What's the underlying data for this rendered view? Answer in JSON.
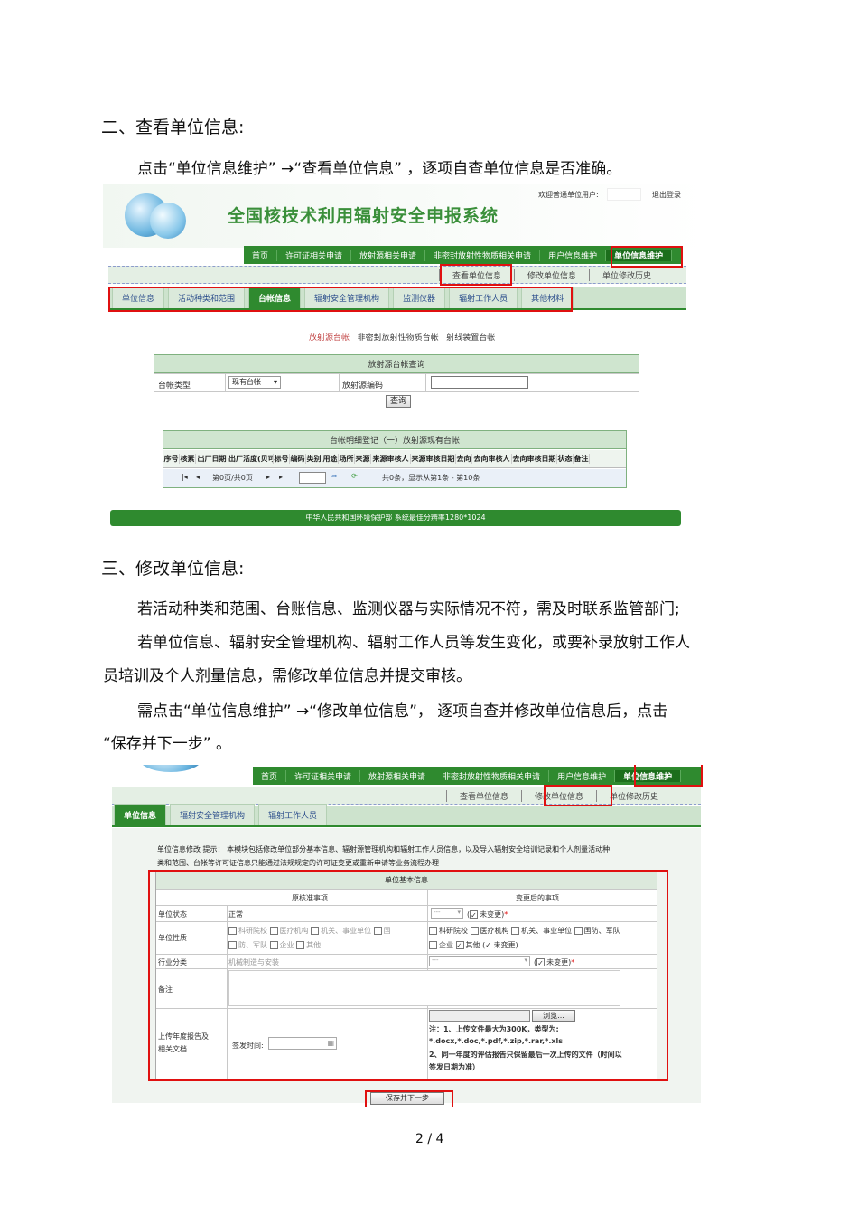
{
  "doc": {
    "h2a": "二、查看单位信息:",
    "p1": "点击“单位信息维护” →“查看单位信息” ，逐项自查单位信息是否准确。",
    "h2b": "三、修改单位信息:",
    "p2": "若活动种类和范围、台账信息、监测仪器与实际情况不符，需及时联系监管部门;",
    "p3a": "若单位信息、辐射安全管理机构、辐射工作人员等发生变化，或要补录放射工作人",
    "p3b": "员培训及个人剂量信息，需修改单位信息并提交审核。",
    "p4a": "需点击“单位信息维护” →“修改单位信息”， 逐项自查并修改单位信息后，点击",
    "p4b": "“保存并下一步” 。",
    "page": "2 / 4"
  },
  "shot1": {
    "sys_title": "全国核技术利用辐射安全申报系统",
    "welcome": "欢迎普通单位用户:",
    "logout": "退出登录",
    "nav": [
      "首页",
      "许可证相关申请",
      "放射源相关申请",
      "非密封放射性物质相关申请",
      "用户信息维护",
      "单位信息维护"
    ],
    "subnav": [
      "查看单位信息",
      "修改单位信息",
      "单位修改历史"
    ],
    "tabs": [
      "单位信息",
      "活动种类和范围",
      "台帐信息",
      "辐射安全管理机构",
      "监测仪器",
      "辐射工作人员",
      "其他材料"
    ],
    "ledger_links": [
      "放射源台帐",
      "非密封放射性物质台帐",
      "射线装置台帐"
    ],
    "query_title": "放射源台帐查询",
    "ledger_type_label": "台帐类型",
    "ledger_type_value": "现有台帐",
    "source_code_label": "放射源编码",
    "query_btn": "查询",
    "detail_title": "台帐明细登记（一）放射源现有台帐",
    "columns": [
      "序号",
      "核素",
      "出厂日期",
      "出厂活度(贝可)",
      "标号",
      "编码",
      "类别",
      "用途",
      "场所",
      "来源",
      "来源审核人",
      "来源审核日期",
      "去向",
      "去向审核人",
      "去向审核日期",
      "状态",
      "备注"
    ],
    "pager": "第0页/共0页",
    "pager_info": "共0条，显示从第1条 - 第10条",
    "footer": "中华人民共和国环境保护部  系统最佳分辨率1280*1024"
  },
  "shot2": {
    "nav": [
      "首页",
      "许可证相关申请",
      "放射源相关申请",
      "非密封放射性物质相关申请",
      "用户信息维护",
      "单位信息维护"
    ],
    "subnav": [
      "查看单位信息",
      "修改单位信息",
      "单位修改历史"
    ],
    "tabs": [
      "单位信息",
      "辐射安全管理机构",
      "辐射工作人员"
    ],
    "note1": "单位信息修改  提示： 本模块包括修改单位部分基本信息、辐射源管理机构和辐射工作人员信息，以及导入辐射安全培训记录和个人剂量活动种",
    "note2": "类和范围、台帐等许可证信息只能通过法规规定的许可证变更或重新申请等业务流程办理",
    "table_title": "单位基本信息",
    "col_orig": "原核准事项",
    "col_new": "变更后的事项",
    "row_status": "单位状态",
    "status_orig": "正常",
    "unchanged": "未变更",
    "row_nature": "单位性质",
    "nature_opts": [
      "科研院校",
      "医疗机构",
      "机关、事业单位",
      "国防、军队",
      "企业",
      "其他"
    ],
    "nature_opts_orig_l1": [
      "科研院校",
      "医疗机构",
      "机关、事业单位",
      "国"
    ],
    "nature_opts_orig_l2": [
      "防、军队",
      "企业",
      "其他"
    ],
    "nature_new_l1": [
      "科研院校",
      "医疗机构",
      "机关、事业单位",
      "国防、军队"
    ],
    "nature_new_l2": [
      "企业",
      "其他"
    ],
    "row_industry": "行业分类",
    "industry_orig": "机械制造与安装",
    "industry_new": "---",
    "status_new": "---",
    "row_remark": "备注",
    "row_upload_l1": "上传年度报告及",
    "row_upload_l2": "相关文档",
    "sign_time": "签发时间:",
    "browse": "浏览...",
    "upload_note1": "注：1、上传文件最大为300K，类型为:",
    "upload_note2": "*.docx,*.doc,*.pdf,*.zip,*.rar,*.xls",
    "upload_note3": "2、同一年度的评估报告只保留最后一次上传的文件（时间以",
    "upload_note4": "签发日期为准）",
    "save_btn": "保存并下一步"
  },
  "colors": {
    "nav_green": "#2f8a2f",
    "highlight_red": "#e01010",
    "link_blue": "#2c4e8c"
  }
}
